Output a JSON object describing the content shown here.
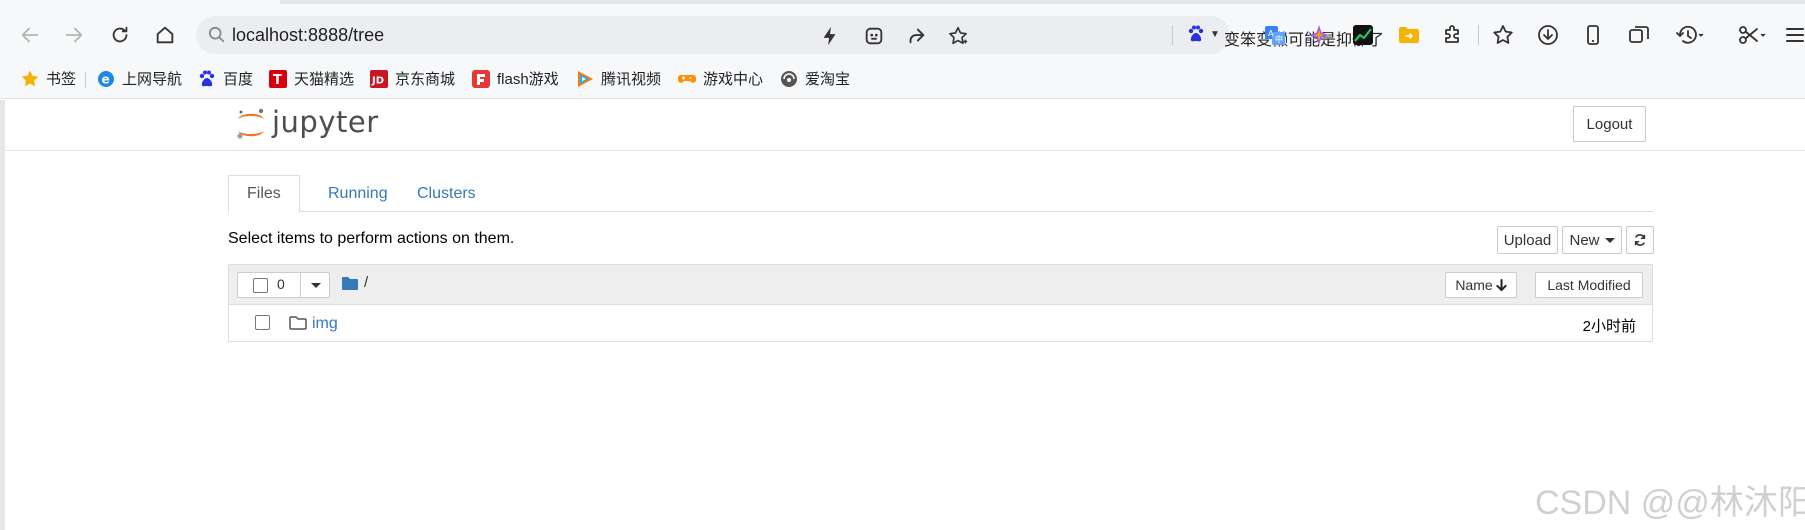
{
  "browser": {
    "url": "localhost:8888/tree",
    "search_hint": "变笨变懒可能是抑郁了"
  },
  "bookmarks": [
    {
      "label": "书签",
      "icon": "star-icon"
    },
    {
      "label": "上网导航",
      "icon": "ie-icon"
    },
    {
      "label": "百度",
      "icon": "baidu-icon"
    },
    {
      "label": "天猫精选",
      "icon": "tmall-icon"
    },
    {
      "label": "京东商城",
      "icon": "jd-icon"
    },
    {
      "label": "flash游戏",
      "icon": "flash-game-icon"
    },
    {
      "label": "腾讯视频",
      "icon": "tencent-video-icon"
    },
    {
      "label": "游戏中心",
      "icon": "gamepad-icon"
    },
    {
      "label": "爱淘宝",
      "icon": "taobao-icon"
    }
  ],
  "jupyter": {
    "logo_text": "jupyter",
    "logout_label": "Logout",
    "tabs": [
      {
        "label": "Files",
        "active": true
      },
      {
        "label": "Running",
        "active": false
      },
      {
        "label": "Clusters",
        "active": false
      }
    ],
    "instructions": "Select items to perform actions on them.",
    "upload_label": "Upload",
    "new_label": "New",
    "selected_count": "0",
    "breadcrumb": "/",
    "name_sort_label": "Name",
    "last_modified_label": "Last Modified",
    "files": [
      {
        "name": "img",
        "type": "folder",
        "modified": "2小时前"
      }
    ]
  },
  "watermark": "CSDN @@林沐阳",
  "colors": {
    "link": "#337ab7",
    "jupyter_orange": "#f37626"
  }
}
